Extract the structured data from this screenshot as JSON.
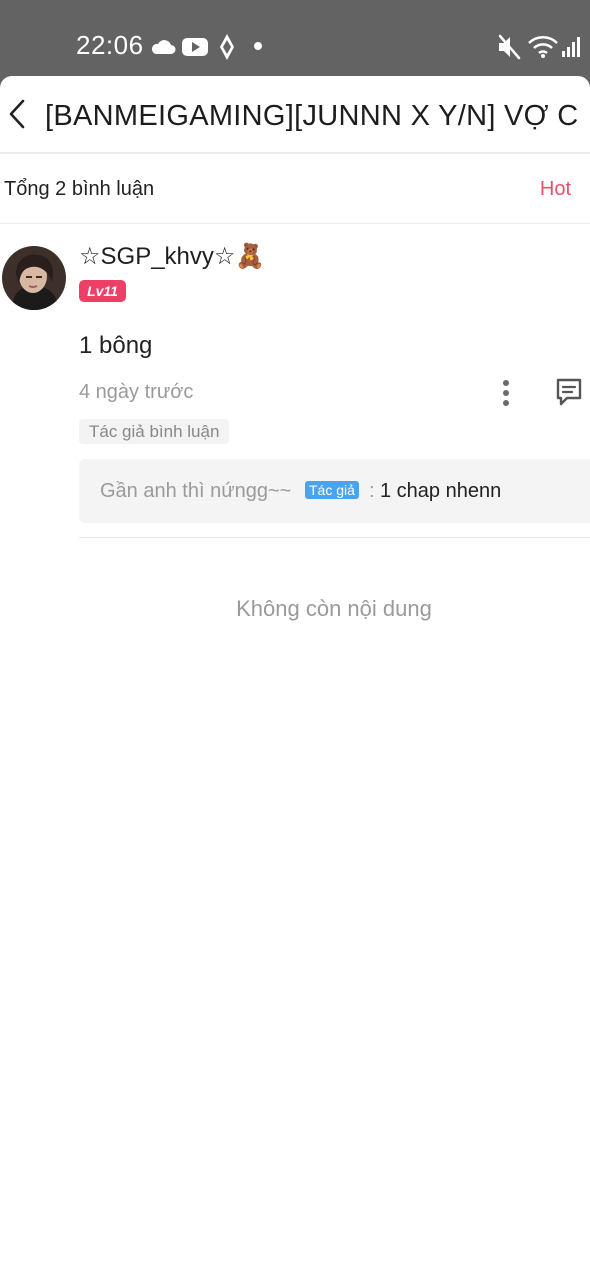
{
  "status_bar": {
    "time": "22:06",
    "icons": [
      "cloud-icon",
      "youtube-icon",
      "app-icon",
      "dot-icon",
      "mute-icon",
      "wifi-icon",
      "signal-icon"
    ]
  },
  "header": {
    "back_icon": "chevron-left-icon",
    "title": "[BANMEIGAMING][JUNNN X Y/N] VỢ C"
  },
  "comments_bar": {
    "count_label": "Tổng 2 bình luận",
    "sort_label": "Hot"
  },
  "comment": {
    "username": "☆SGP_khvy☆🧸",
    "level": "Lv11",
    "text": "1 bông",
    "time": "4 ngày trước",
    "author_tag": "Tác giả bình luận",
    "reply": {
      "name": "Gần anh thì nứngg~~",
      "author_tag": "Tác giả",
      "colon": ":",
      "text": "1 chap nhenn"
    }
  },
  "end_message": "Không còn nội dung",
  "colors": {
    "accent": "#e8526a",
    "level_badge": "#ee3f66",
    "author_tag": "#4aa3ee",
    "status_bar": "#636363"
  }
}
